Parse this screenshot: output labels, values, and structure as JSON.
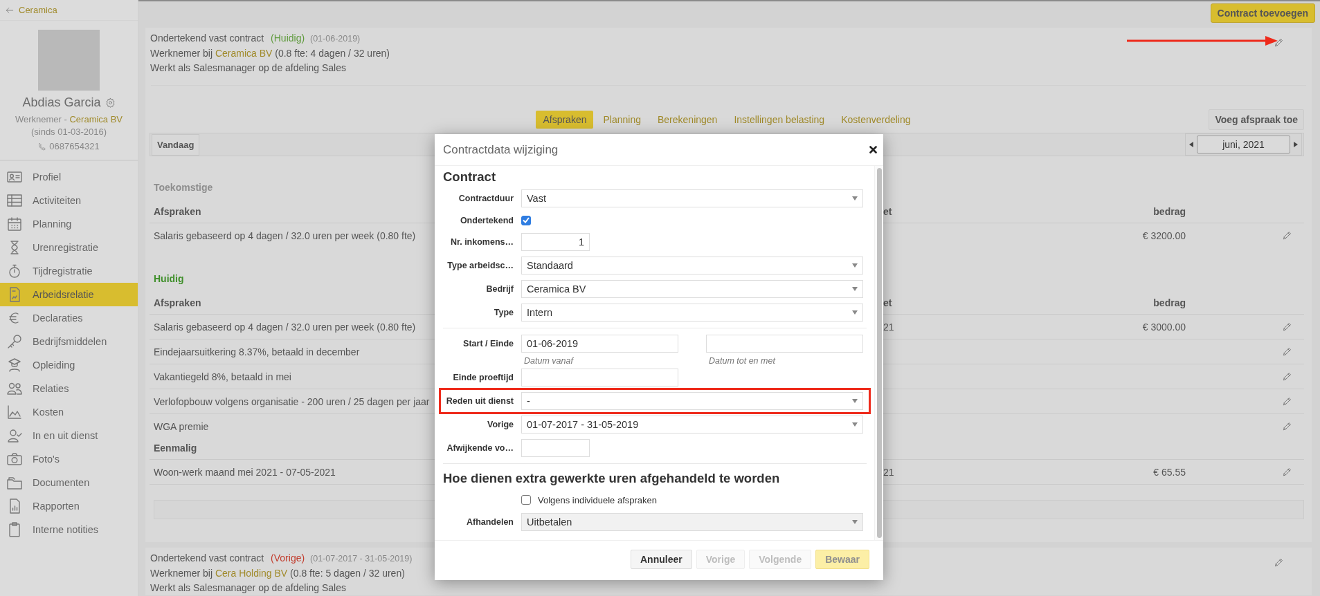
{
  "sidebar": {
    "back_link": "Ceramica",
    "profile": {
      "name": "Abdias Garcia",
      "role": "Werknemer -",
      "company": "Ceramica BV",
      "since": "(sinds 01-03-2016)",
      "phone": "0687654321"
    },
    "items": [
      {
        "label": "Profiel",
        "selected": false
      },
      {
        "label": "Activiteiten",
        "selected": false
      },
      {
        "label": "Planning",
        "selected": false
      },
      {
        "label": "Urenregistratie",
        "selected": false
      },
      {
        "label": "Tijdregistratie",
        "selected": false
      },
      {
        "label": "Arbeidsrelatie",
        "selected": true
      },
      {
        "label": "Declaraties",
        "selected": false
      },
      {
        "label": "Bedrijfsmiddelen",
        "selected": false
      },
      {
        "label": "Opleiding",
        "selected": false
      },
      {
        "label": "Relaties",
        "selected": false
      },
      {
        "label": "Kosten",
        "selected": false
      },
      {
        "label": "In en uit dienst",
        "selected": false
      },
      {
        "label": "Foto's",
        "selected": false
      },
      {
        "label": "Documenten",
        "selected": false
      },
      {
        "label": "Rapporten",
        "selected": false
      },
      {
        "label": "Interne notities",
        "selected": false
      }
    ]
  },
  "header": {
    "add_contract_button": "Contract toevoegen"
  },
  "contracts": [
    {
      "title": "Ondertekend vast contract",
      "status": "(Huidig)",
      "color": "#5e9a3c",
      "date": "(01-06-2019)",
      "employer_prefix": "Werknemer bij",
      "employer": "Ceramica BV",
      "hours": "(0.8 fte: 4 dagen / 32 uren)",
      "role": "Werkt als Salesmanager op de afdeling Sales",
      "annotated": true,
      "agreements": {
        "tabs": [
          {
            "label": "Afspraken",
            "selected": true
          },
          {
            "label": "Planning",
            "selected": false
          },
          {
            "label": "Berekeningen",
            "selected": false
          },
          {
            "label": "Instellingen belasting",
            "selected": false
          },
          {
            "label": "Kostenverdeling",
            "selected": false
          }
        ],
        "add_button": "Voeg afspraak toe",
        "today_button": "Vandaag",
        "month": "juni, 2021",
        "sections": [
          {
            "title": "Toekomstige",
            "kind": "future",
            "groups": [
              {
                "title": "Afspraken",
                "columns": [
                  "et",
                  "bedrag"
                ],
                "rows": [
                  {
                    "description": "Salaris gebaseerd op 4 dagen / 32.0 uren per week (0.80 fte)",
                    "amount": "€ 3200.00"
                  }
                ]
              }
            ]
          },
          {
            "title": "Huidig",
            "kind": "current",
            "groups": [
              {
                "title": "Afspraken",
                "columns": [
                  "et",
                  "bedrag"
                ],
                "rows": [
                  {
                    "description": "Salaris gebaseerd op 4 dagen / 32.0 uren per week (0.80 fte)",
                    "column_2": "21",
                    "amount": "€ 3000.00"
                  },
                  {
                    "description": "Eindejaarsuitkering 8.37%, betaald in december"
                  },
                  {
                    "description": "Vakantiegeld 8%, betaald in mei"
                  },
                  {
                    "description": "Verlofopbouw volgens organisatie - 200 uren / 25 dagen per jaar"
                  },
                  {
                    "description": "WGA premie"
                  }
                ]
              },
              {
                "title": "Eenmalig",
                "rows": [
                  {
                    "description": "Woon-werk maand mei 2021 - 07-05-2021",
                    "column_2": "21",
                    "amount": "€ 65.55"
                  }
                ]
              }
            ]
          }
        ]
      }
    },
    {
      "title": "Ondertekend vast contract",
      "status": "(Vorige)",
      "color": "#c23b2c",
      "date": "(01-07-2017 - 31-05-2019)",
      "employer_prefix": "Werknemer bij",
      "employer": "Cera Holding BV",
      "hours": "(0.8 fte: 5 dagen / 32 uren)",
      "role": "Werkt als Salesmanager op de afdeling Sales",
      "annotated": false
    }
  ],
  "modal": {
    "title": "Contractdata wijziging",
    "fields": [
      {
        "kind": "heading",
        "text": "Contract"
      },
      {
        "kind": "select",
        "label": "Contractduur",
        "value": "Vast",
        "disabled": false,
        "highlighted": false
      },
      {
        "kind": "checkbox",
        "label": "Ondertekend",
        "checked": true,
        "highlighted": false
      },
      {
        "kind": "number",
        "label": "Nr. inkomens…",
        "value": "1",
        "highlighted": false
      },
      {
        "kind": "select",
        "label": "Type arbeidsc…",
        "value": "Standaard",
        "disabled": false,
        "highlighted": false
      },
      {
        "kind": "select",
        "label": "Bedrijf",
        "value": "Ceramica BV",
        "disabled": false,
        "highlighted": false
      },
      {
        "kind": "select",
        "label": "Type",
        "value": "Intern",
        "disabled": false,
        "highlighted": false
      },
      {
        "kind": "divider"
      },
      {
        "kind": "daterange",
        "label": "Start / Einde",
        "inputs": [
          {
            "value": "01-06-2019",
            "hint": "Datum vanaf"
          },
          {
            "hint": "Datum tot en met"
          }
        ],
        "highlighted": false
      },
      {
        "kind": "date",
        "label": "Einde proeftijd",
        "highlighted": false
      },
      {
        "kind": "select",
        "label": "Reden uit dienst",
        "value": "-",
        "disabled": false,
        "highlighted": true
      },
      {
        "kind": "select",
        "label": "Vorige",
        "value": "01-07-2017 - 31-05-2019",
        "disabled": false,
        "highlighted": false
      },
      {
        "kind": "number",
        "label": "Afwijkende vo…",
        "highlighted": false
      },
      {
        "kind": "divider"
      },
      {
        "kind": "heading",
        "text": "Hoe dienen extra gewerkte uren afgehandeld te worden"
      },
      {
        "kind": "option",
        "text": "Volgens individuele afspraken",
        "checked": false
      },
      {
        "kind": "select",
        "label": "Afhandelen",
        "value": "Uitbetalen",
        "disabled": true,
        "highlighted": false
      }
    ],
    "buttons": [
      {
        "label": "Annuleer",
        "kind": "default",
        "disabled": false
      },
      {
        "label": "Vorige",
        "kind": "default",
        "disabled": true
      },
      {
        "label": "Volgende",
        "kind": "default",
        "disabled": true
      },
      {
        "label": "Bewaar",
        "kind": "primary",
        "disabled": true
      }
    ]
  }
}
